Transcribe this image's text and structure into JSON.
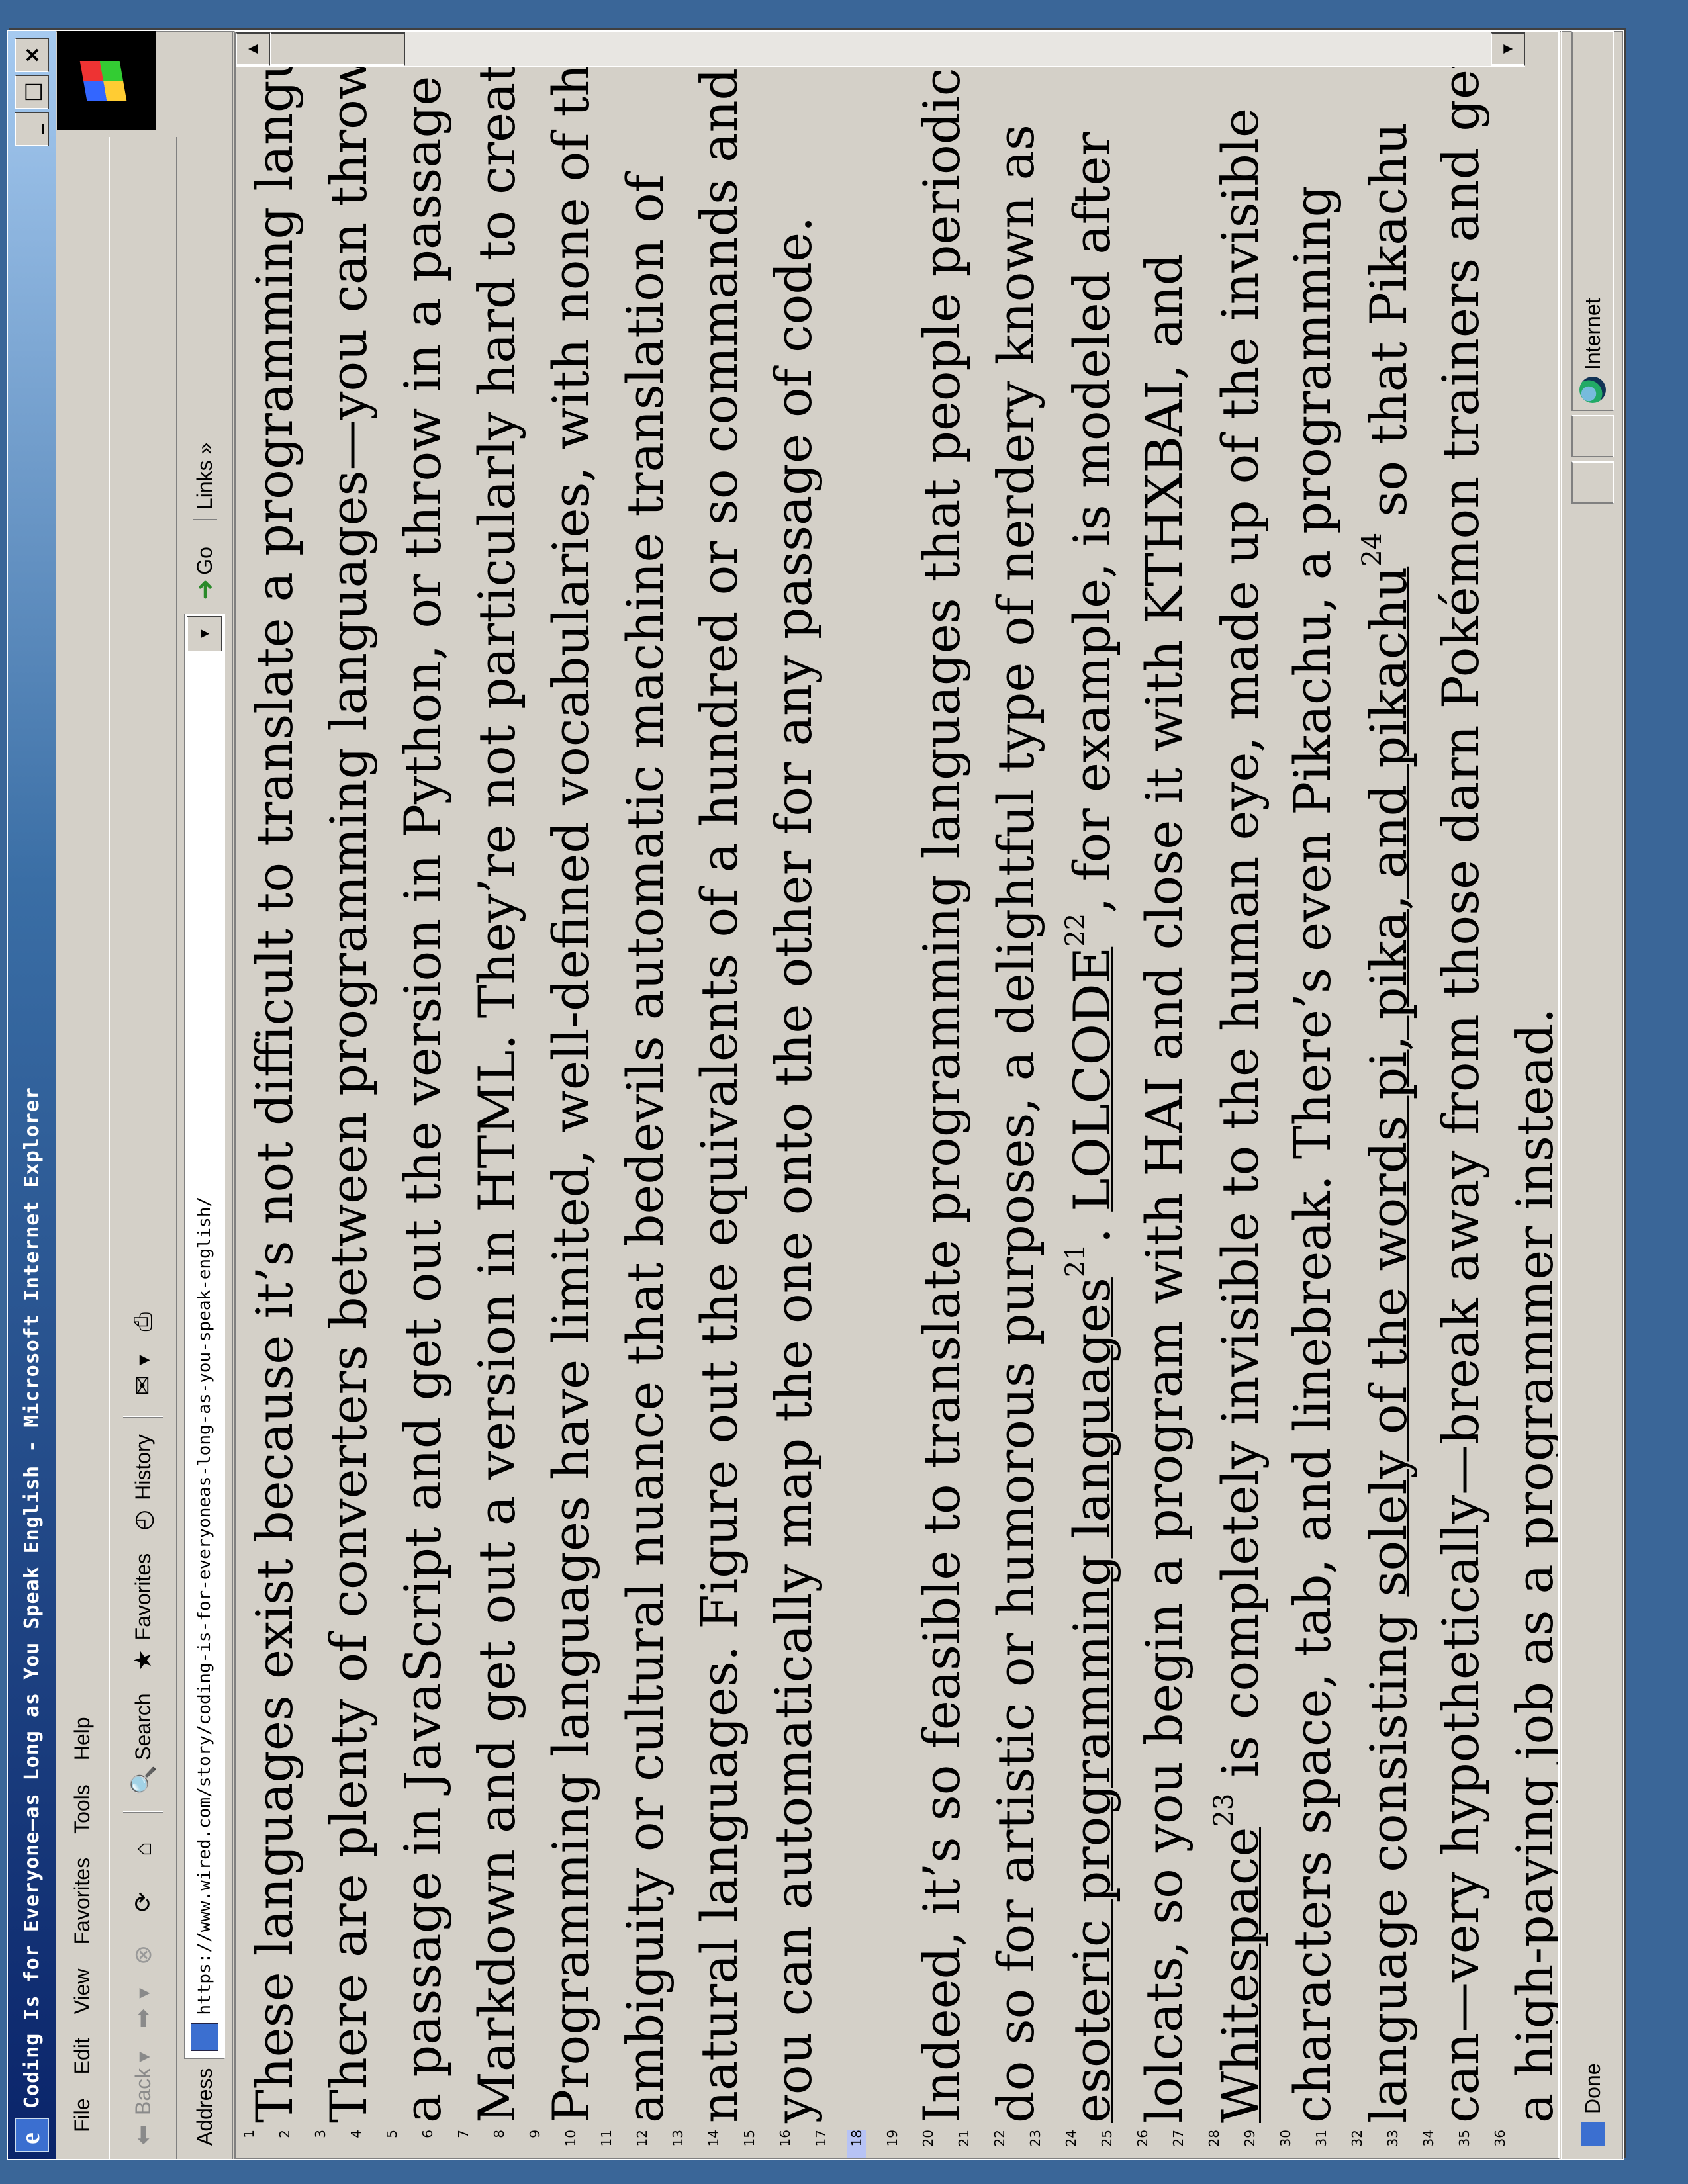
{
  "window": {
    "title": "Coding Is for Everyone—as Long as You Speak English - Microsoft Internet Explorer",
    "minimize": "_",
    "maximize": "□",
    "close": "×"
  },
  "menu": [
    "File",
    "Edit",
    "View",
    "Favorites",
    "Tools",
    "Help"
  ],
  "toolbar": {
    "back": "Back",
    "search": "Search",
    "favorites": "Favorites",
    "history": "History"
  },
  "address": {
    "label": "Address",
    "url": "https://www.wired.com/story/coding-is-for-everyoneas-long-as-you-speak-english/",
    "go": "Go",
    "links": "Links »"
  },
  "line_numbers": [
    "1",
    "2",
    "3",
    "4",
    "5",
    "6",
    "7",
    "8",
    "9",
    "10",
    "11",
    "12",
    "13",
    "14",
    "15",
    "16",
    "17",
    "18",
    "19",
    "20",
    "21",
    "22",
    "23",
    "24",
    "25",
    "26",
    "27",
    "28",
    "29",
    "30",
    "31",
    "32",
    "33",
    "34",
    "35",
    "36"
  ],
  "highlighted_line": "18",
  "paragraphs": [
    {
      "lines": [
        "These languages exist because it’s not difficult to translate a programming language.",
        "There are plenty of converters between programming languages—you can throw in",
        "a passage in JavaScript and get out the version in Python, or throw in a passage in",
        "Markdown and get out a version in HTML. They’re not particularly hard to create.",
        "Programming languages have limited, well-defined vocabularies, with none of the",
        "ambiguity or cultural nuance that bedevils automatic machine translation of",
        "natural languages. Figure out the equivalents of a hundred or so commands and",
        "you can automatically map the one onto the other for any passage of code."
      ]
    }
  ],
  "p2": {
    "l1": "Indeed, it’s so feasible to translate programming languages that people periodically",
    "l2": "do so for artistic or humorous purposes, a delightful type of nerdery known as",
    "l3_link": "esoteric programming languages",
    "l3_sup": "21",
    "l3_mid": ". ",
    "l3_link2": "LOLCODE",
    "l3_sup2": "22",
    "l3_rest": ", for example, is modeled after",
    "l4": "lolcats, so you begin a program with HAI and close it with KTHXBAI, and",
    "l5_link": "Whitespace",
    "l5_sup": "23",
    "l5_rest": " is completely invisible to the human eye, made up of the invisible",
    "l6": "characters space, tab, and linebreak. There’s even Pikachu, a programming",
    "l7_pre": "language consisting ",
    "l7_link": "solely of the words pi, pika, and pikachu",
    "l7_sup": "24",
    "l7_rest": " so that Pikachu",
    "l8": "can—very hypothetically—break away from those darn Pokémon trainers and get",
    "l9": "a high-paying job as a programmer instead."
  },
  "status": {
    "done": "Done",
    "zone": "Internet"
  }
}
